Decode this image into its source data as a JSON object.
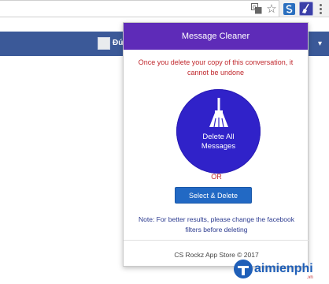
{
  "browser": {
    "user_name": "Đứ",
    "icons": {
      "translate": "translate-icon",
      "star": "bookmark-star-icon",
      "extension_1": "extension-s-icon",
      "extension_2": "message-cleaner-extension-icon",
      "menu": "browser-menu-icon"
    }
  },
  "popup": {
    "title": "Message Cleaner",
    "warning": "Once you delete your copy of this conversation, it cannot be undone",
    "delete_all_line1": "Delete All",
    "delete_all_line2": "Messages",
    "or_text": "OR",
    "select_delete_label": "Select & Delete",
    "note": "Note: For better results, please change the facebook filters before deleting",
    "footer": "CS Rockz App Store © 2017",
    "colors": {
      "header": "#5e2bb8",
      "delete_circle": "#3022c9",
      "button": "#2269c4",
      "warning_text": "#c0282d",
      "note_text": "#2b3a8f"
    }
  },
  "page": {
    "facebook_bar_color": "#3b5998"
  },
  "watermark": {
    "brand": "aimienphi",
    "sub": ".vn"
  }
}
